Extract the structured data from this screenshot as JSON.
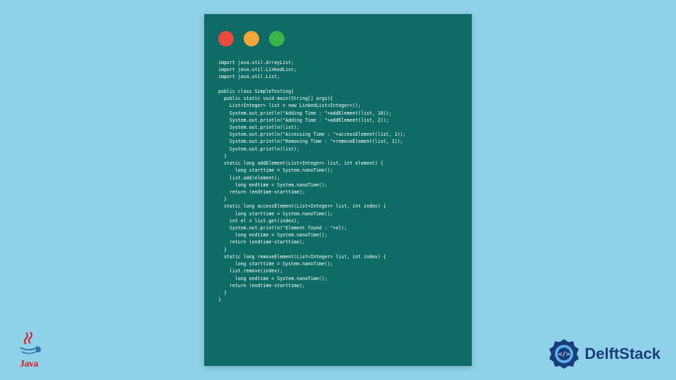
{
  "code_lines": [
    "import java.util.ArrayList;",
    "import java.util.LinkedList;",
    "import java.util.List;",
    "",
    "public class SimpleTesting{",
    "  public static void main(String[] args){",
    "    List<Integer> list = new LinkedList<Integer>();",
    "    System.out.println(\"Adding Time : \"+addElement(list, 10));",
    "    System.out.println(\"Adding Time : \"+addElement(list, 2));",
    "    System.out.println(list);",
    "    System.out.println(\"Accessing Time : \"+accessElement(list, 1));",
    "    System.out.println(\"Removing Time : \"+removeElement(list, 1));",
    "    System.out.println(list);",
    "  }",
    "  static long addElement(List<Integer> list, int element) {",
    "      long starttime = System.nanoTime();",
    "    list.add(element);",
    "      long endtime = System.nanoTime();",
    "    return (endtime-starttime);",
    "  }",
    "  static long accessElement(List<Integer> list, int index) {",
    "      long starttime = System.nanoTime();",
    "    int el = list.get(index);",
    "    System.out.println(\"Element found : \"+el);",
    "      long endtime = System.nanoTime();",
    "    return (endtime-starttime);",
    "  }",
    "  static long removeElement(List<Integer> list, int index) {",
    "      long starttime = System.nanoTime();",
    "    list.remove(index);",
    "      long endtime = System.nanoTime();",
    "    return (endtime-starttime);",
    "  }",
    "}"
  ],
  "logos": {
    "java_label": "Java",
    "delft_label": "DelftStack"
  },
  "colors": {
    "bg": "#8FD1E8",
    "window": "#0E6B66",
    "dot_red": "#E94B3C",
    "dot_yellow": "#F2A73B",
    "dot_green": "#3BB44A",
    "java_red": "#D81F26",
    "java_blue": "#3174B0",
    "delft_blue": "#1A3D7C"
  }
}
